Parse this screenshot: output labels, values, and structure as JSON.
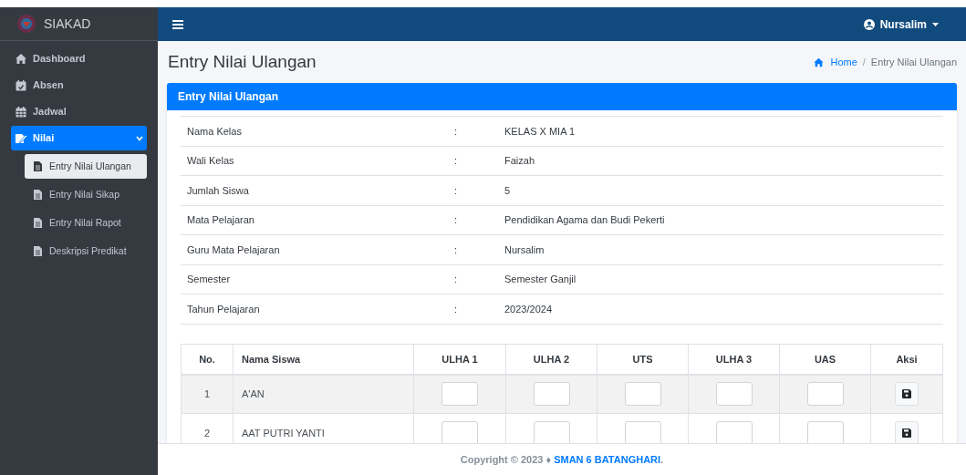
{
  "brand": {
    "title": "SIAKAD"
  },
  "sidebar": {
    "items": [
      {
        "label": "Dashboard",
        "selected": false
      },
      {
        "label": "Absen",
        "selected": false
      },
      {
        "label": "Jadwal",
        "selected": false
      },
      {
        "label": "Nilai",
        "selected": true,
        "expanded": true,
        "children": [
          {
            "label": "Entry Nilai Ulangan",
            "selected": true
          },
          {
            "label": "Entry Nilai Sikap",
            "selected": false
          },
          {
            "label": "Entry Nilai Rapot",
            "selected": false
          },
          {
            "label": "Deskripsi Predikat",
            "selected": false
          }
        ]
      }
    ]
  },
  "topbar": {
    "user": "Nursalim"
  },
  "page": {
    "title": "Entry Nilai Ulangan",
    "breadcrumb": [
      {
        "label": "Home",
        "kind": "link"
      },
      {
        "label": "/",
        "kind": "separator"
      },
      {
        "label": "Entry Nilai Ulangan",
        "kind": "current"
      }
    ]
  },
  "card": {
    "title": "Entry Nilai Ulangan",
    "info": [
      {
        "label": "Nama Kelas",
        "sep": ":",
        "value": "KELAS X MIA 1"
      },
      {
        "label": "Wali Kelas",
        "sep": ":",
        "value": "Faizah"
      },
      {
        "label": "Jumlah Siswa",
        "sep": ":",
        "value": "5"
      },
      {
        "label": "Mata Pelajaran",
        "sep": ":",
        "value": "Pendidikan Agama dan Budi Pekerti"
      },
      {
        "label": "Guru Mata Pelajaran",
        "sep": ":",
        "value": "Nursalim"
      },
      {
        "label": "Semester",
        "sep": ":",
        "value": "Semester Ganjil"
      },
      {
        "label": "Tahun Pelajaran",
        "sep": ":",
        "value": "2023/2024"
      }
    ],
    "table": {
      "columns": [
        "No.",
        "Nama Siswa",
        "ULHA 1",
        "ULHA 2",
        "UTS",
        "ULHA 3",
        "UAS",
        "Aksi"
      ],
      "rows": [
        {
          "no": "1",
          "name": "A'AN"
        },
        {
          "no": "2",
          "name": "AAT PUTRI YANTI"
        }
      ]
    }
  },
  "footer": {
    "text": "Copyright © 2023 ♦",
    "link": "SMAN 6 BATANGHARI",
    "end": "."
  }
}
